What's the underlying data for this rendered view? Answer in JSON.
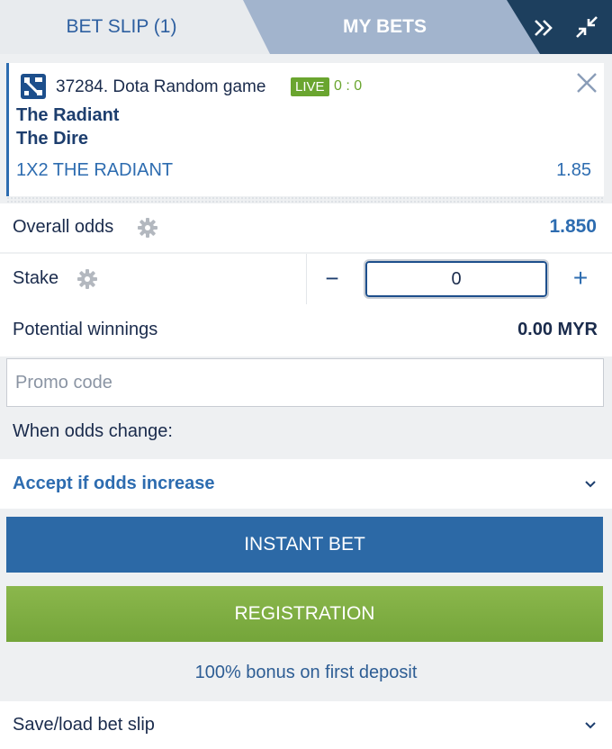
{
  "tabs": {
    "betslip": "BET SLIP (1)",
    "mybets": "MY BETS"
  },
  "event": {
    "title": "37284. Dota Random game",
    "live": "LIVE",
    "score": "0 : 0",
    "team1": "The Radiant",
    "team2": "The Dire",
    "market": "1X2 THE RADIANT",
    "odd": "1.85"
  },
  "overall": {
    "label": "Overall odds",
    "value": "1.850"
  },
  "stake": {
    "label": "Stake",
    "minus": "−",
    "plus": "+",
    "value": "0"
  },
  "potential": {
    "label": "Potential winnings",
    "value": "0.00 MYR"
  },
  "promo": {
    "placeholder": "Promo code"
  },
  "odds_change": {
    "label": "When odds change:",
    "selected": "Accept if odds increase"
  },
  "buttons": {
    "instant": "INSTANT BET",
    "register": "REGISTRATION"
  },
  "bonus": "100% bonus on first deposit",
  "save": {
    "label": "Save/load bet slip"
  },
  "colors": {
    "accent": "#2c69a6",
    "live": "#6aa52f",
    "register": "#7aab3f",
    "navy": "#1d3f5e"
  }
}
